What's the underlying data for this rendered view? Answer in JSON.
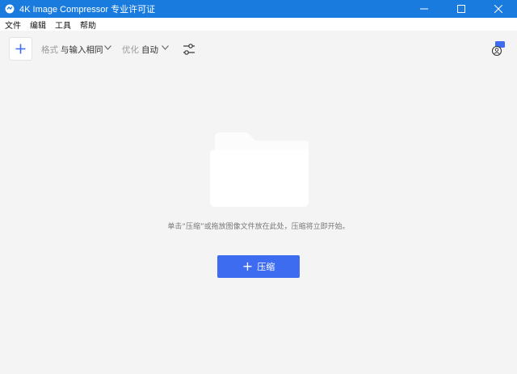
{
  "window": {
    "title": "4K Image Compressor 专业许可证"
  },
  "menu": {
    "items": [
      "文件",
      "编辑",
      "工具",
      "帮助"
    ]
  },
  "toolbar": {
    "add_symbol": "+",
    "format_label": "格式",
    "format_value": "与输入相同",
    "optimize_label": "优化",
    "optimize_value": "自动"
  },
  "main": {
    "drop_hint": "单击“压缩”或拖放图像文件放在此处，压缩将立即开始。",
    "compress_button": "压缩",
    "compress_symbol": "+"
  },
  "colors": {
    "titlebar": "#1a7bde",
    "accent": "#3e6cf0",
    "background": "#f4f4f4"
  },
  "icons": [
    "app-icon",
    "minimize-icon",
    "maximize-icon",
    "close-icon",
    "plus-icon",
    "chevron-down-icon",
    "settings-sliders-icon",
    "account-icon",
    "folder-icon"
  ]
}
